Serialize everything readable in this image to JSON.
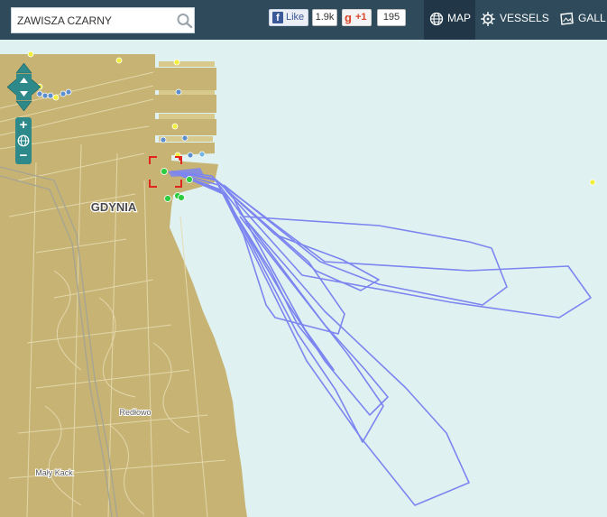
{
  "search": {
    "value": "ZAWISZA CZARNY",
    "placeholder": ""
  },
  "social": {
    "facebook_label": "Like",
    "facebook_count": "1.9k",
    "gplus_label": "+1",
    "gplus_count": "195"
  },
  "nav": {
    "map_label": "MAP",
    "vessels_label": "VESSELS",
    "gallery_label": "GALL"
  },
  "map": {
    "city_label": "GDYNIA",
    "district_labels": [
      "Redłowo",
      "Mały Kack"
    ],
    "colors": {
      "sea": "#dff1f0",
      "land": "#c7b474",
      "track": "#7c85f0",
      "topbar": "#2e4a5b",
      "nav_active": "#213747",
      "selection": "#e0251d"
    },
    "markers": {
      "yellow": "#f1ef3a",
      "blue": "#5d8fcf",
      "green": "#2ecc40"
    }
  }
}
